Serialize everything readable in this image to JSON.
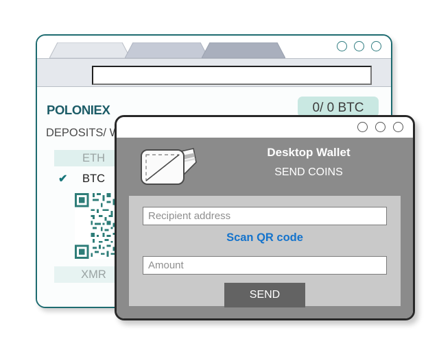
{
  "browser": {
    "tabs": [
      {
        "name": "tab-one",
        "label": ""
      },
      {
        "name": "tab-two",
        "label": ""
      },
      {
        "name": "tab-three",
        "label": ""
      }
    ],
    "url_value": "",
    "url_placeholder": "",
    "window_controls": [
      "minimize-circle",
      "maximize-circle",
      "close-circle"
    ],
    "accent_color": "#1d6b70",
    "page": {
      "logo_text": "POLONIEX",
      "balance_pill": "0/ 0 BTC",
      "heading": "DEPOSITS/ W",
      "coins": [
        {
          "ticker": "ETH",
          "selected": false
        },
        {
          "ticker": "BTC",
          "selected": true
        },
        {
          "ticker": "XMR",
          "selected": false
        }
      ],
      "check_glyph": "✔",
      "qr_icon": "qr-code-icon",
      "qr_color": "#2e7d78"
    }
  },
  "wallet": {
    "window_controls": [
      "minimize-circle",
      "maximize-circle",
      "close-circle"
    ],
    "icon": "wallet-icon",
    "title": "Desktop Wallet",
    "subtitle": "SEND COINS",
    "form": {
      "recipient_value": "",
      "recipient_placeholder": "Recipient address",
      "scan_link": "Scan QR code",
      "scan_link_color": "#1473cc",
      "amount_value": "",
      "amount_placeholder": "Amount",
      "send_label": "SEND"
    }
  }
}
